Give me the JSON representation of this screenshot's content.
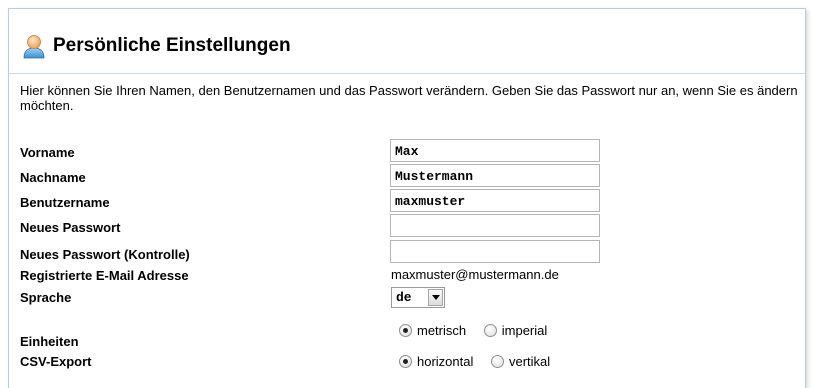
{
  "header": {
    "title": "Persönliche Einstellungen",
    "icon": "user-icon"
  },
  "intro_text": "Hier können Sie Ihren Namen, den Benutzernamen und das Passwort verändern. Geben Sie das Passwort nur an, wenn Sie es ändern möchten.",
  "form": {
    "vorname": {
      "label": "Vorname",
      "value": "Max"
    },
    "nachname": {
      "label": "Nachname",
      "value": "Mustermann"
    },
    "benutzername": {
      "label": "Benutzername",
      "value": "maxmuster"
    },
    "neues_passwort": {
      "label": "Neues Passwort",
      "value": ""
    },
    "passwort_kontrolle": {
      "label": "Neues Passwort (Kontrolle)",
      "value": ""
    },
    "email": {
      "label": "Registrierte E-Mail Adresse",
      "value": "maxmuster@mustermann.de"
    },
    "sprache": {
      "label": "Sprache",
      "value": "de"
    },
    "einheiten": {
      "label": "Einheiten",
      "options": [
        "metrisch",
        "imperial"
      ],
      "selected": "metrisch"
    },
    "csv_export": {
      "label": "CSV-Export",
      "options": [
        "horizontal",
        "vertikal"
      ],
      "selected": "horizontal"
    }
  },
  "colors": {
    "panel_border": "#b8cde4",
    "header_divider": "#c9d7e6"
  }
}
